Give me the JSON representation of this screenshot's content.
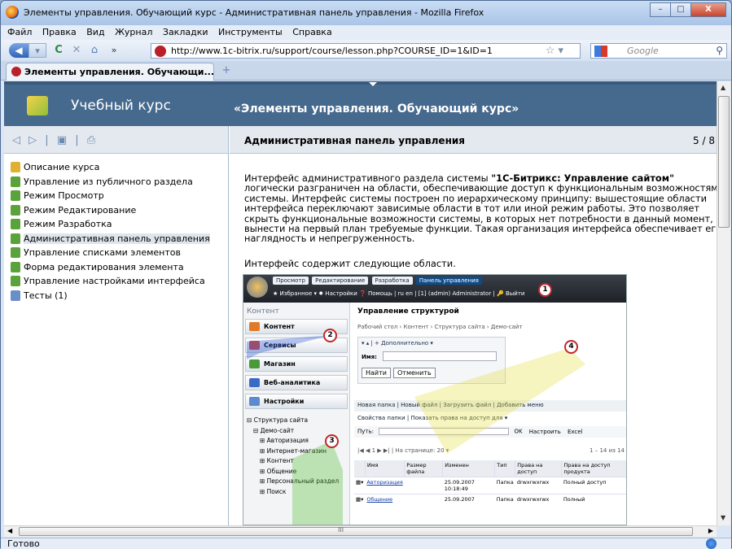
{
  "window": {
    "title": "Элементы управления. Обучающий курс - Административная панель управления - Mozilla Firefox",
    "controls": [
      "–",
      "□",
      "X"
    ]
  },
  "menu": [
    "Файл",
    "Правка",
    "Вид",
    "Журнал",
    "Закладки",
    "Инструменты",
    "Справка"
  ],
  "nav": {
    "back": "◀",
    "forward": "▾",
    "reload": "C",
    "stop": "✕",
    "home": "⌂",
    "more": "»",
    "url": "http://www.1c-bitrix.ru/support/course/lesson.php?COURSE_ID=1&ID=1",
    "star": "☆ ▾",
    "search_placeholder": "Google",
    "search_icon": "⚲"
  },
  "tab": {
    "label": "Элементы управления. Обучающи...",
    "new_tab": "+"
  },
  "header": {
    "brand": "Учебный курс",
    "course_title": "«Элементы управления. Обучающий курс»"
  },
  "toolbar": {
    "prev": "◁",
    "next": "▷",
    "sep": "|",
    "bookmark": "▣",
    "print": "⎙"
  },
  "toc": [
    {
      "label": "Описание курса"
    },
    {
      "label": "Управление из публичного раздела"
    },
    {
      "label": "Режим Просмотр"
    },
    {
      "label": "Режим Редактирование"
    },
    {
      "label": "Режим Разработка"
    },
    {
      "label": "Административная панель управления"
    },
    {
      "label": "Управление списками элементов"
    },
    {
      "label": "Форма редактирования элемента"
    },
    {
      "label": "Управление настройками интерфейса"
    },
    {
      "label": "Тесты (1)"
    }
  ],
  "page": {
    "title": "Административная панель управления",
    "counter": "5 / 8",
    "intro_before": "Интерфейс административного раздела системы ",
    "product": "\"1С-Битрикс: Управление сайтом\"",
    "intro_after": " логически разграничен на области, обеспечивающие доступ к функциональным возможностям системы. Интерфейс системы построен по иерархическому принципу: вышестоящие области интерфейса переключают зависимые области в тот или иной режим работы. Это позволяет скрыть функциональные возможности системы, в которых нет потребности в данный момент, и вынести на первый план требуемые функции. Такая организация интерфейса обеспечивает его наглядность и непрегруженность.",
    "areas": "Интерфейс содержит следующие области."
  },
  "screenshot": {
    "tabs": [
      "Просмотр",
      "Редактирование",
      "Разработка",
      "Панель управления"
    ],
    "bar2": "★ Избранное ▾  ✹ Настройки  ❓ Помощь  |  ru  en  |  [1] (admin) Administrator  |  🔑 Выйти",
    "left_head": "Контент",
    "buttons": [
      "Контент",
      "Сервисы",
      "Магазин",
      "Веб-аналитика",
      "Настройки"
    ],
    "tree": [
      "⊟ Структура сайта",
      "⊟ Демо-сайт",
      "⊞ Авторизация",
      "⊞ Интернет-магазин",
      "⊞ Контент",
      "⊞ Общение",
      "⊞ Персональный раздел",
      "⊞ Поиск"
    ],
    "heading": "Управление структурой",
    "breadcrumb": "Рабочий стол › Контент › Структура сайта › Демо-сайт",
    "form_row1": "▾ ▴ | + Дополнительно ▾",
    "form_label": "Имя:",
    "find": "Найти",
    "cancel": "Отменить",
    "toolbar1": "Новая папка | Новый файл | Загрузить файл | Добавить меню",
    "toolbar2": "Свойства папки | Показать права на доступ для ▾",
    "path_label": "Путь:",
    "ok": "OK",
    "customize": "Настроить",
    "excel": "Excel",
    "pager": "|◀ ◀ 1 ▶ ▶| | На странице: 20 ▾",
    "pager_right": "1 – 14 из 14",
    "columns": [
      "",
      "Имя",
      "Размер файла",
      "Изменен",
      "Тип",
      "Права на доступ",
      "Права на доступ продукта"
    ],
    "rows": [
      [
        "▦▾",
        "Авторизация",
        "",
        "25.09.2007 10:18:49",
        "Папка",
        "drwxrwxrwx",
        "Полный доступ"
      ],
      [
        "▦▾",
        "Общение",
        "",
        "25.09.2007",
        "Папка",
        "drwxrwxrwx",
        "Полный"
      ]
    ],
    "badges": [
      "1",
      "2",
      "3",
      "4"
    ]
  },
  "scroll": {
    "up": "▲",
    "down": "▼",
    "left": "◀",
    "right": "▶",
    "grip": "III"
  },
  "status": {
    "text": "Готово"
  },
  "colors": {
    "header": "#46698e",
    "title_bar": "#a9c4e8",
    "badge": "#c1272d"
  }
}
